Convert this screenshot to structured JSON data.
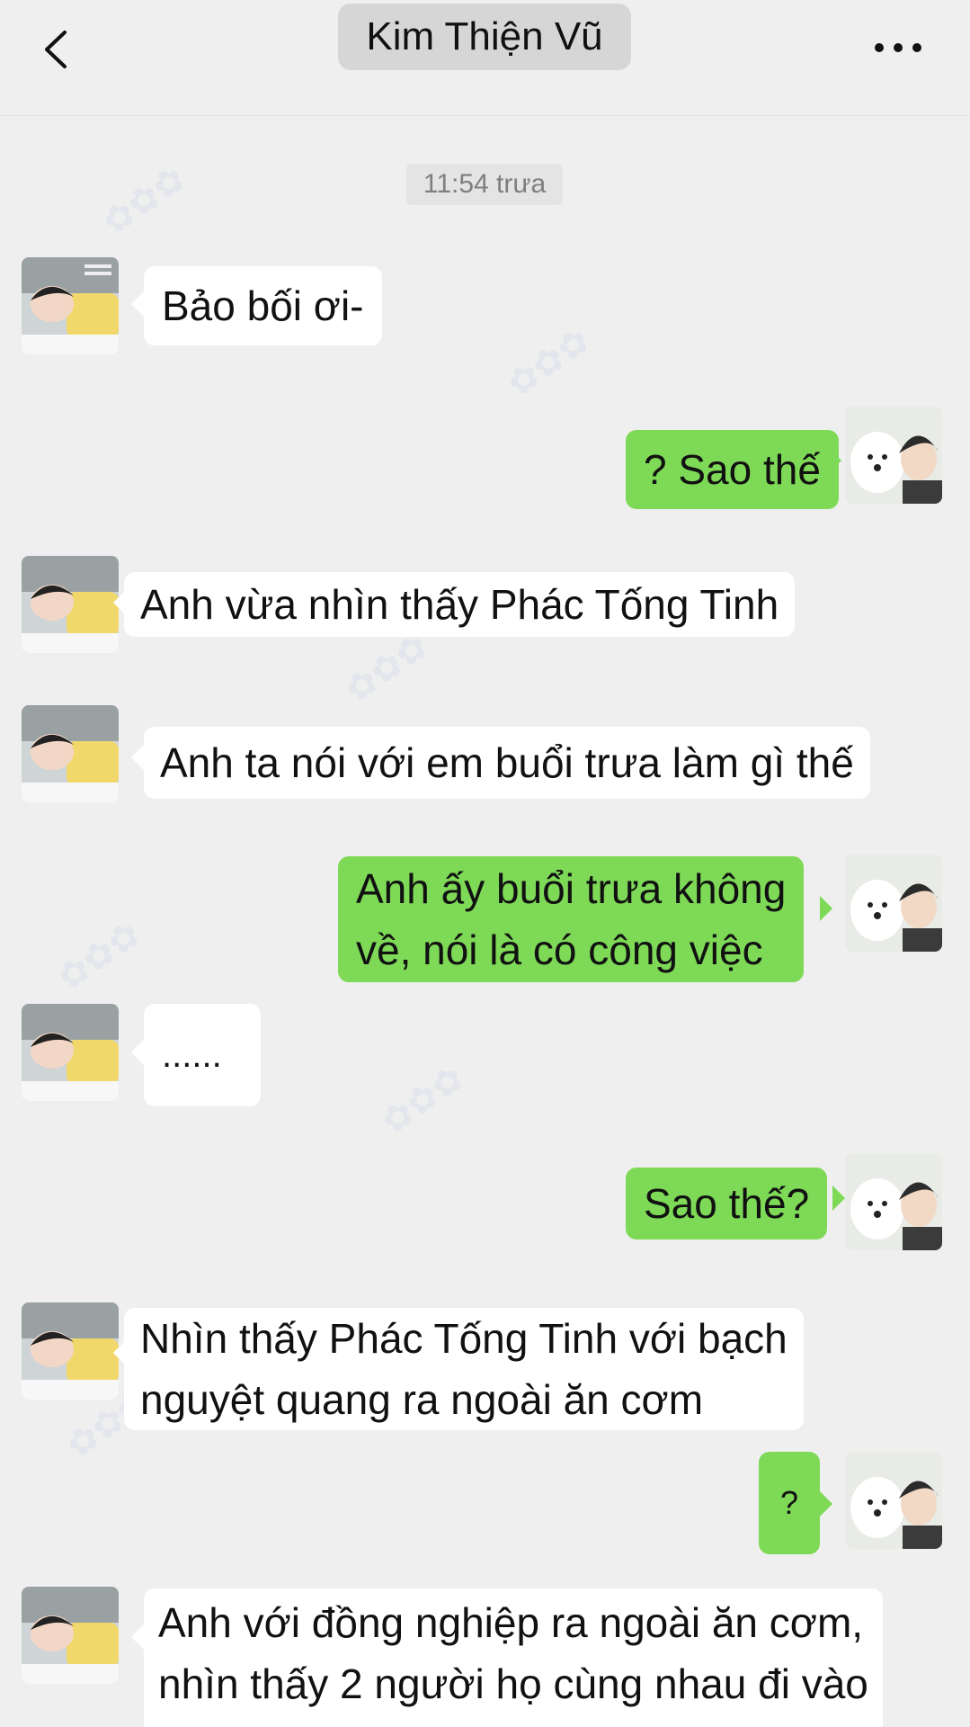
{
  "header": {
    "title": "Kim Thiện Vũ",
    "back_icon": "chevron-left-icon",
    "more_label": "..."
  },
  "timestamp": "11:54 trưa",
  "messages": [
    {
      "side": "in",
      "text": "Bảo bối ơi-"
    },
    {
      "side": "out",
      "text": "? Sao thế"
    },
    {
      "side": "in",
      "text": "Anh vừa nhìn thấy Phác Tống Tinh"
    },
    {
      "side": "in",
      "text": "Anh ta nói với em buổi trưa làm gì thế"
    },
    {
      "side": "out",
      "lines": [
        "Anh ấy buổi trưa không",
        "về, nói là có công việc"
      ]
    },
    {
      "side": "in",
      "text": "......"
    },
    {
      "side": "out",
      "text": "Sao thế?"
    },
    {
      "side": "in",
      "lines": [
        "Nhìn thấy Phác Tống Tinh với bạch",
        "nguyệt quang ra ngoài ăn cơm"
      ]
    },
    {
      "side": "out",
      "text": "?"
    },
    {
      "side": "in",
      "lines": [
        "Anh với đồng nghiệp ra ngoài ăn cơm,",
        "nhìn thấy 2 người họ cùng nhau đi vào"
      ]
    }
  ],
  "colors": {
    "background": "#efefef",
    "outgoing_bubble": "#7ed957",
    "incoming_bubble": "#ffffff"
  }
}
